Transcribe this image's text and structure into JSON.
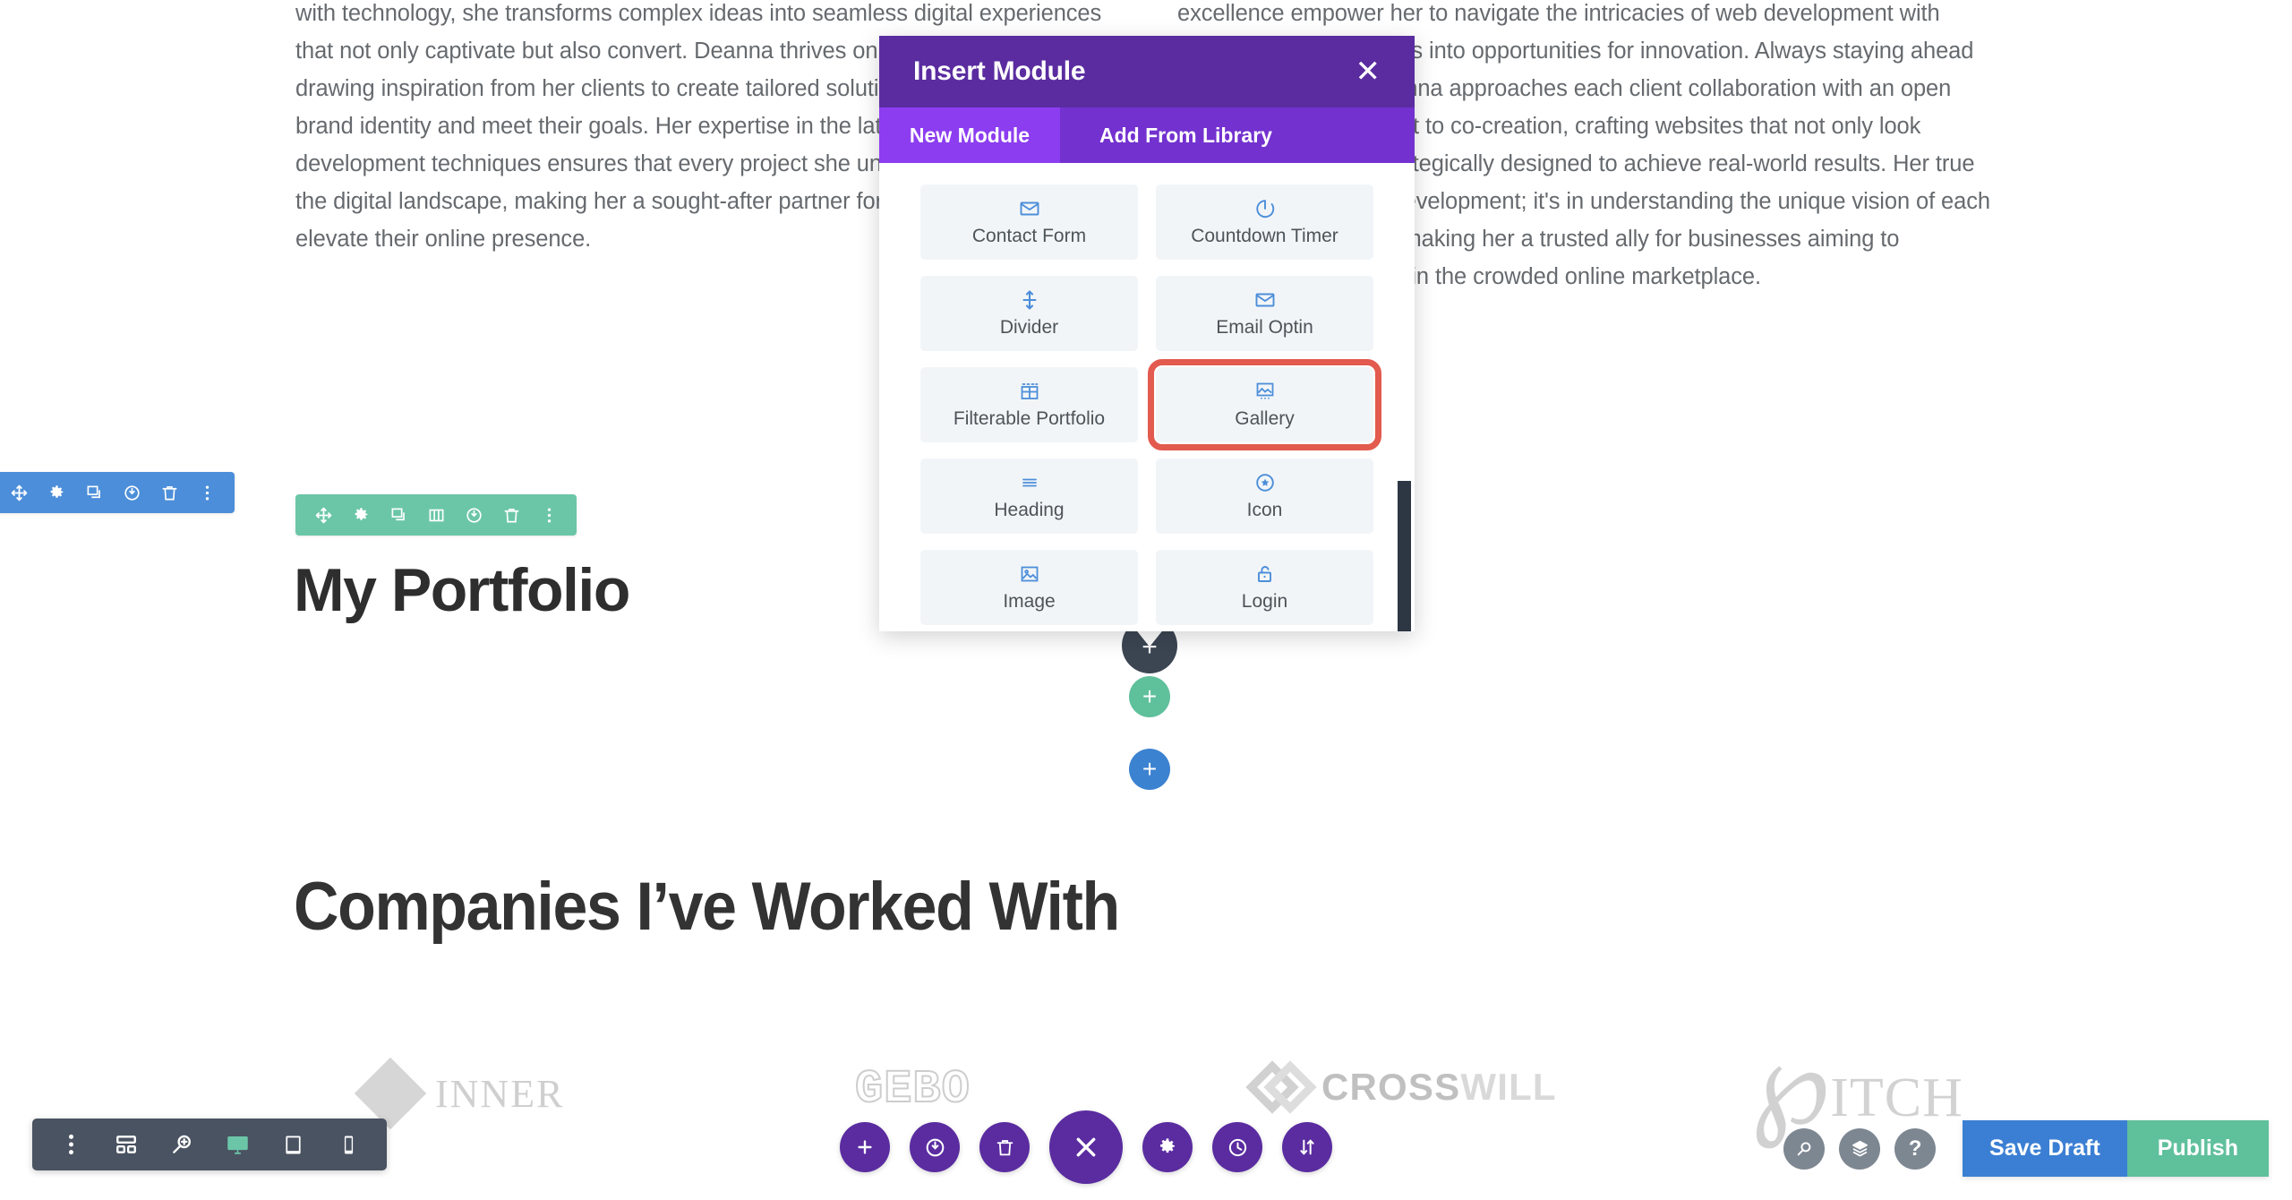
{
  "page": {
    "bio_left": "design, web design, and web development uniquely positions her to craft visually stunning and highly functional websites. With an innate ability to blend creativity with technology, she transforms complex ideas into seamless digital experiences that not only captivate but also convert. Deanna thrives on collaboration, often drawing inspiration from her clients to create tailored solutions that reflect their brand identity and meet their goals. Her expertise in the latest design trends and development techniques ensures that every project she undertakes stands out in the digital landscape, making her a sought-after partner for brands looking to elevate their online presence.",
    "bio_right": "unwavering dedication, ensuring that each project is not just a task but a passion-driven journey. Her meticulous attention to detail and relentless pursuit of excellence empower her to navigate the intricacies of web development with ease, turning challenges into opportunities for innovation. Always staying ahead of industry trends, Deanna approaches each client collaboration with an open mind and a commitment to co-creation, crafting websites that not only look exceptional but are strategically designed to achieve real-world results. Her true strength is not just in development; it's in understanding the unique vision of each brand she works with, making her a trusted ally for businesses aiming to distinguish themselves in the crowded online marketplace.",
    "portfolio_heading": "My Portfolio",
    "companies_heading": "Companies I’ve Worked With"
  },
  "logos": [
    {
      "name": "INNER",
      "mark": "diamond-mark"
    },
    {
      "name": "GEBO",
      "mark": "outline-text"
    },
    {
      "name_dark": "CROSS",
      "name_light": "WILL",
      "mark": "cross-mark"
    },
    {
      "name": "ITCH",
      "mark": "clef-mark",
      "clef": "℘"
    }
  ],
  "modal": {
    "title": "Insert Module",
    "close_label": "✕",
    "tabs": [
      {
        "label": "New Module",
        "active": true
      },
      {
        "label": "Add From Library",
        "active": false
      }
    ],
    "modules": [
      {
        "label": "Contact Form",
        "icon": "envelope-icon",
        "highlighted": false
      },
      {
        "label": "Countdown Timer",
        "icon": "timer-icon",
        "highlighted": false
      },
      {
        "label": "Divider",
        "icon": "divider-icon",
        "highlighted": false
      },
      {
        "label": "Email Optin",
        "icon": "envelope-icon",
        "highlighted": false
      },
      {
        "label": "Filterable Portfolio",
        "icon": "grid-icon",
        "highlighted": false
      },
      {
        "label": "Gallery",
        "icon": "gallery-icon",
        "highlighted": true
      },
      {
        "label": "Heading",
        "icon": "heading-icon",
        "highlighted": false
      },
      {
        "label": "Icon",
        "icon": "star-circle-icon",
        "highlighted": false
      },
      {
        "label": "Image",
        "icon": "image-icon",
        "highlighted": false
      },
      {
        "label": "Login",
        "icon": "lock-icon",
        "highlighted": false
      }
    ]
  },
  "toolbars": {
    "section": {
      "color": "#4c8ed9",
      "buttons": [
        "move-icon",
        "gear-icon",
        "duplicate-icon",
        "power-icon",
        "trash-icon",
        "more-icon"
      ]
    },
    "row": {
      "color": "#6bc6a8",
      "buttons": [
        "move-icon",
        "gear-icon",
        "duplicate-icon",
        "columns-icon",
        "power-icon",
        "trash-icon",
        "more-icon"
      ]
    }
  },
  "device_bar": {
    "buttons": [
      "more-vertical-icon",
      "wireframe-icon",
      "zoom-icon",
      "desktop-icon",
      "tablet-icon",
      "phone-icon"
    ],
    "active": "desktop-icon"
  },
  "action_bar": {
    "buttons": [
      "add-icon",
      "power-icon",
      "trash-icon",
      "close-icon",
      "gear-icon",
      "history-icon",
      "sort-icon"
    ]
  },
  "right_bar": {
    "icons": [
      "search-icon",
      "layers-icon",
      "help-icon"
    ],
    "help_glyph": "?",
    "save_draft_label": "Save Draft",
    "publish_label": "Publish"
  },
  "add_buttons": {
    "dark_plus": "+",
    "green_plus": "+",
    "blue_plus": "+"
  },
  "colors": {
    "modal_header": "#5a2ca0",
    "modal_tabs": "#7331cf",
    "tab_active": "#8c3df0",
    "highlight": "#e35a4e",
    "blue": "#4c8ed9",
    "green": "#6bc6a8",
    "publish_green": "#5fc09c",
    "save_blue": "#3b7fd4"
  }
}
